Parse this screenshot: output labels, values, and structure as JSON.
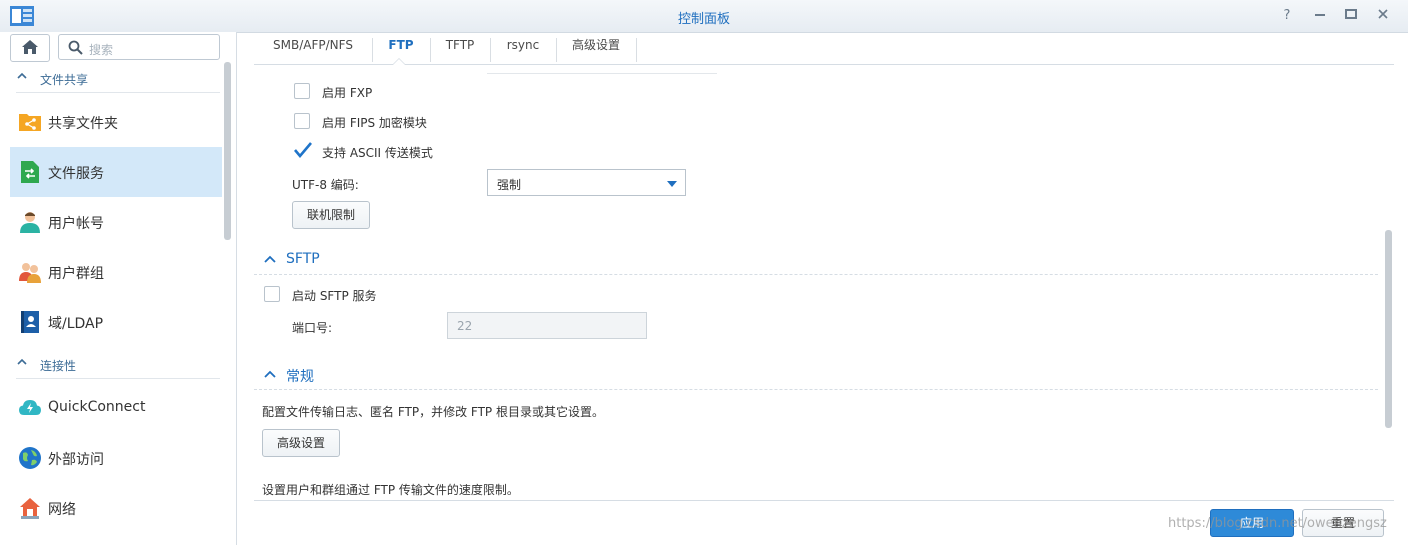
{
  "window": {
    "title": "控制面板",
    "controls": [
      "help-icon",
      "minimize-icon",
      "maximize-icon",
      "close-icon"
    ]
  },
  "sidebar": {
    "search_placeholder": "搜索",
    "sections": [
      {
        "title": "文件共享",
        "items": [
          {
            "label": "共享文件夹",
            "icon": "shared-folder-icon",
            "active": false
          },
          {
            "label": "文件服务",
            "icon": "file-services-icon",
            "active": true
          },
          {
            "label": "用户帐号",
            "icon": "user-icon",
            "active": false
          },
          {
            "label": "用户群组",
            "icon": "group-icon",
            "active": false
          },
          {
            "label": "域/LDAP",
            "icon": "domain-ldap-icon",
            "active": false
          }
        ]
      },
      {
        "title": "连接性",
        "items": [
          {
            "label": "QuickConnect",
            "icon": "quickconnect-icon",
            "active": false
          },
          {
            "label": "外部访问",
            "icon": "external-access-icon",
            "active": false
          },
          {
            "label": "网络",
            "icon": "network-icon",
            "active": false
          }
        ]
      }
    ]
  },
  "tabs": [
    {
      "label": "SMB/AFP/NFS",
      "active": false
    },
    {
      "label": "FTP",
      "active": true
    },
    {
      "label": "TFTP",
      "active": false
    },
    {
      "label": "rsync",
      "active": false
    },
    {
      "label": "高级设置",
      "active": false
    }
  ],
  "ftp": {
    "enable_fxp": {
      "label": "启用 FXP",
      "checked": false
    },
    "enable_fips": {
      "label": "启用 FIPS 加密模块",
      "checked": false
    },
    "ascii_mode": {
      "label": "支持 ASCII 传送模式",
      "checked": true
    },
    "utf8_label": "UTF-8 编码:",
    "utf8_value": "强制",
    "connection_limit_button": "联机限制"
  },
  "sftp": {
    "title": "SFTP",
    "enable": {
      "label": "启动 SFTP 服务",
      "checked": false
    },
    "port_label": "端口号:",
    "port_value": "22"
  },
  "general": {
    "title": "常规",
    "description": "配置文件传输日志、匿名 FTP，并修改 FTP 根目录或其它设置。",
    "advanced_button": "高级设置",
    "speed_description": "设置用户和群组通过 FTP 传输文件的速度限制。"
  },
  "footer": {
    "apply": "应用",
    "reset": "重置"
  },
  "watermark": "https://blog.csdn.net/owenzengsz",
  "colors": {
    "accent": "#1f6fbf",
    "active_item_bg": "#d3e8f9",
    "apply_bg": "#2e8ad8"
  }
}
